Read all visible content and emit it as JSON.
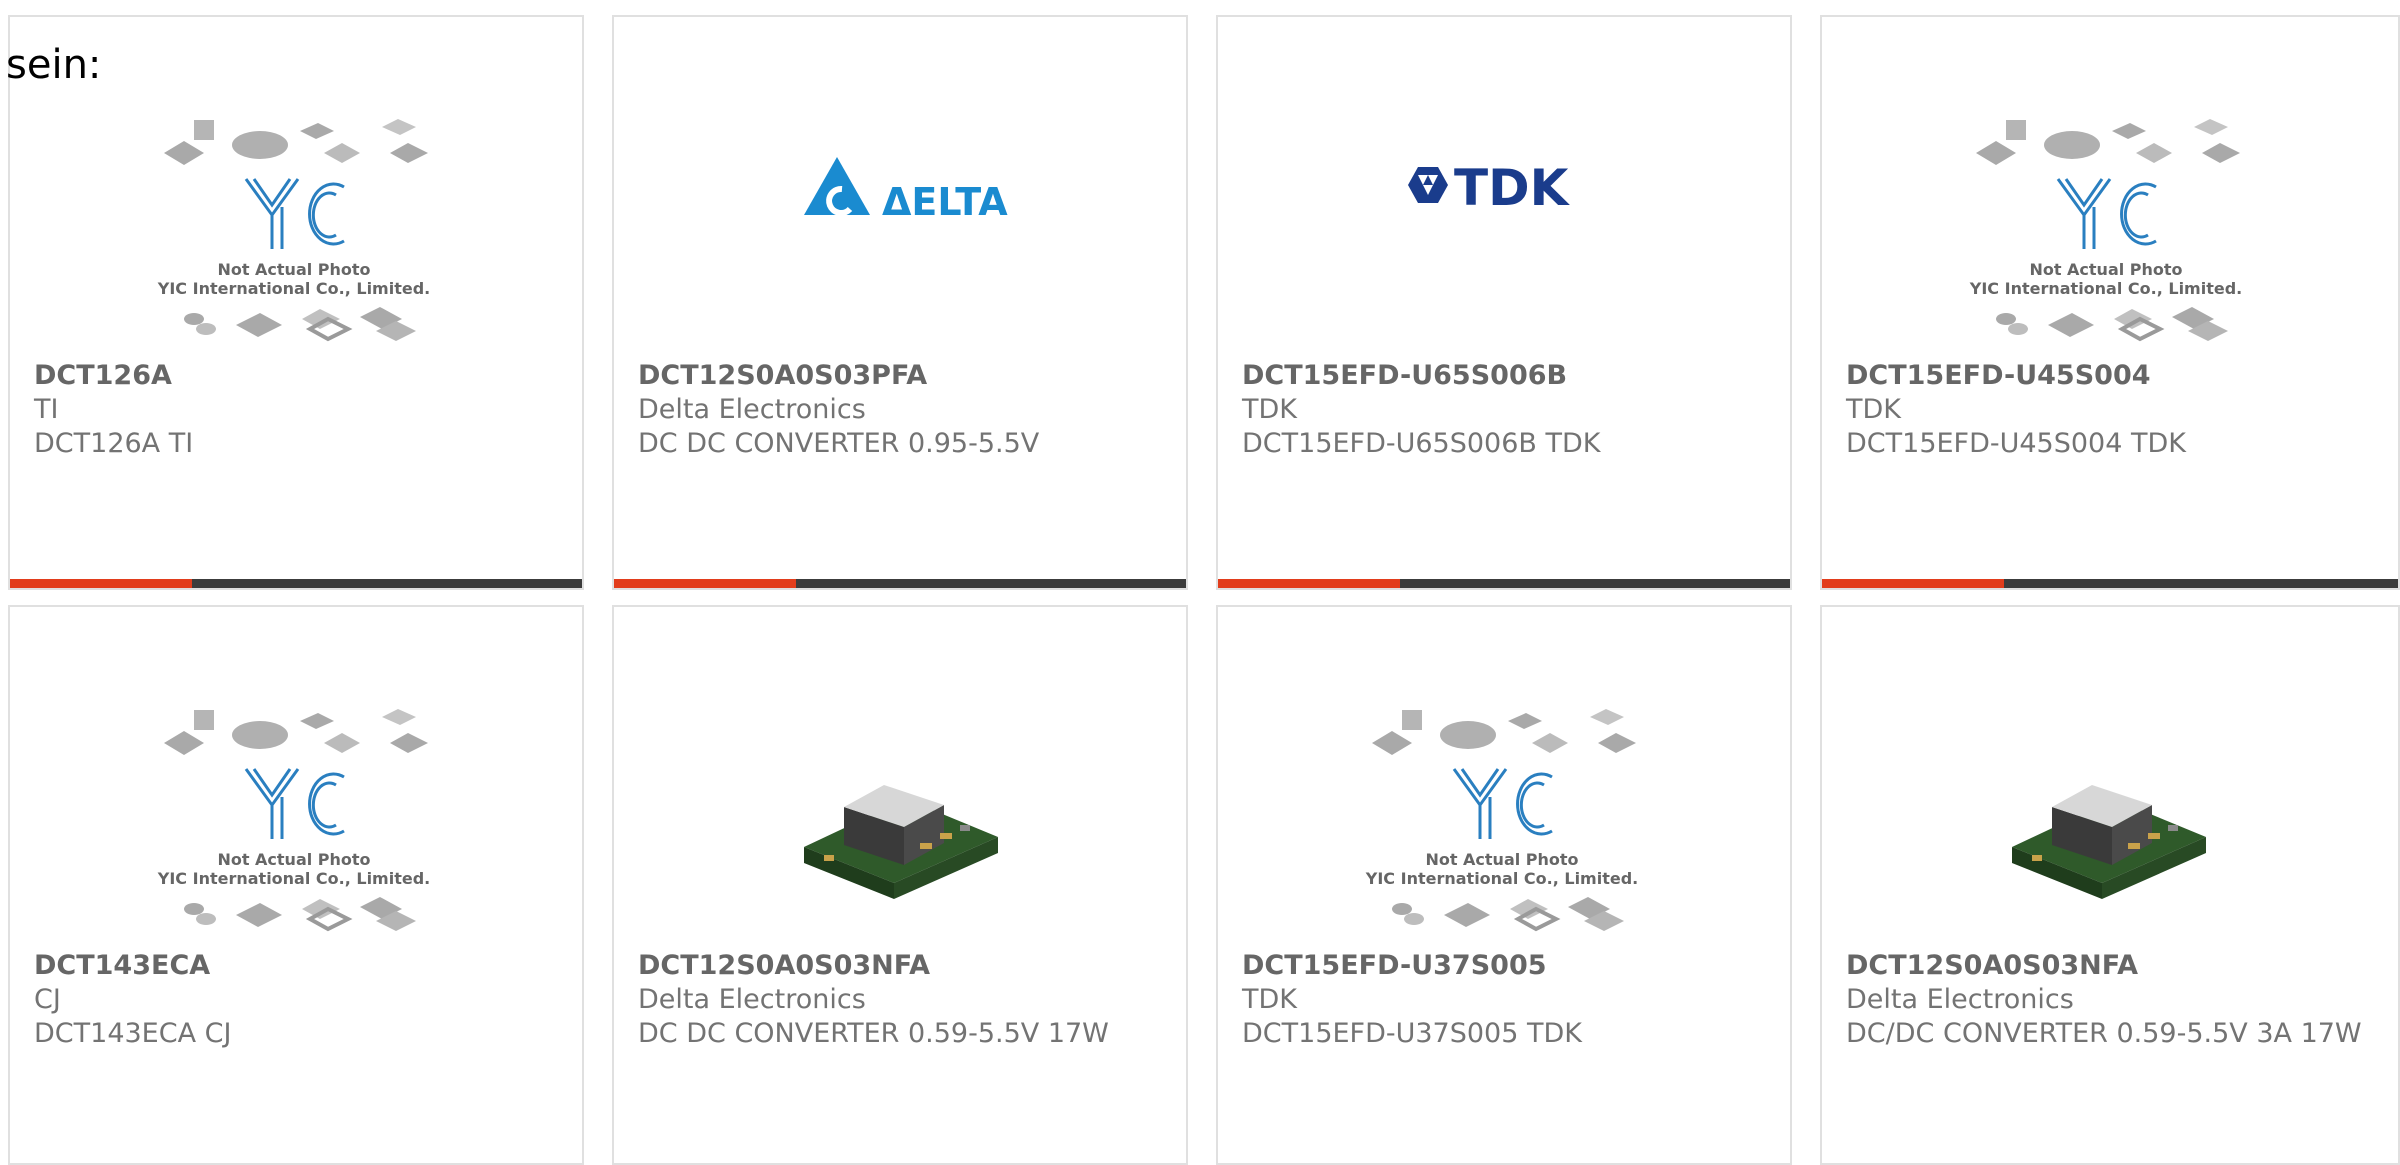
{
  "intro_text": "sein:",
  "colors": {
    "accent": "#e23d1c",
    "bar": "#3c3c3c",
    "text": "#737373",
    "delta_blue": "#1a8bd0",
    "tdk_blue": "#1a3c8c",
    "yic_blue": "#2a7fc0"
  },
  "placeholder": {
    "line1": "Not Actual Photo",
    "line2": "YIC International Co., Limited.",
    "logo": "YIC"
  },
  "brand_logos": {
    "delta": "ΔELTA",
    "tdk": "TDK"
  },
  "products": [
    {
      "part": "DCT126A",
      "manufacturer": "TI",
      "description": "DCT126A TI",
      "image": "yic-placeholder"
    },
    {
      "part": "DCT12S0A0S03PFA",
      "manufacturer": "Delta Electronics",
      "description": "DC DC CONVERTER 0.95-5.5V",
      "image": "delta-logo"
    },
    {
      "part": "DCT15EFD-U65S006B",
      "manufacturer": "TDK",
      "description": "DCT15EFD-U65S006B TDK",
      "image": "tdk-logo"
    },
    {
      "part": "DCT15EFD-U45S004",
      "manufacturer": "TDK",
      "description": "DCT15EFD-U45S004 TDK",
      "image": "yic-placeholder"
    },
    {
      "part": "DCT143ECA",
      "manufacturer": "CJ",
      "description": "DCT143ECA CJ",
      "image": "yic-placeholder"
    },
    {
      "part": "DCT12S0A0S03NFA",
      "manufacturer": "Delta Electronics",
      "description": "DC DC CONVERTER 0.59-5.5V 17W",
      "image": "module-photo"
    },
    {
      "part": "DCT15EFD-U37S005",
      "manufacturer": "TDK",
      "description": "DCT15EFD-U37S005 TDK",
      "image": "yic-placeholder"
    },
    {
      "part": "DCT12S0A0S03NFA",
      "manufacturer": "Delta Electronics",
      "description": "DC/DC CONVERTER 0.59-5.5V 3A 17W",
      "image": "module-photo"
    }
  ]
}
